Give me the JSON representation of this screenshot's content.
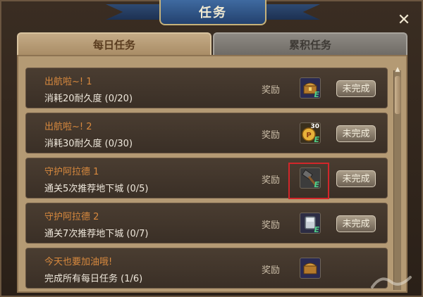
{
  "window": {
    "title": "任务",
    "close_glyph": "✕"
  },
  "tabs": [
    {
      "label": "每日任务",
      "active": true
    },
    {
      "label": "累积任务",
      "active": false
    }
  ],
  "reward_label": "奖励",
  "tasks": [
    {
      "name": "出航啦~! 1",
      "desc": "消耗20耐久度 (0/20)",
      "reward_icon": "treasure-chest-icon",
      "status": "未完成"
    },
    {
      "name": "出航啦~! 2",
      "desc": "消耗30耐久度 (0/30)",
      "reward_icon": "gold-coin-30-icon",
      "status": "未完成",
      "reward_badge": "30"
    },
    {
      "name": "守护阿拉德 1",
      "desc": "通关5次推荐地下城 (0/5)",
      "reward_icon": "hammer-icon",
      "status": "未完成",
      "highlighted": true
    },
    {
      "name": "守护阿拉德 2",
      "desc": "通关7次推荐地下城 (0/7)",
      "reward_icon": "stone-block-icon",
      "status": "未完成"
    },
    {
      "name": "今天也要加油哦!",
      "desc": "完成所有每日任务 (1/6)",
      "reward_icon": "treasure-chest-icon",
      "status": ""
    }
  ],
  "colors": {
    "task_name": "#d8893e",
    "highlight": "#d2262a",
    "tab_active": "#c4ab86"
  }
}
